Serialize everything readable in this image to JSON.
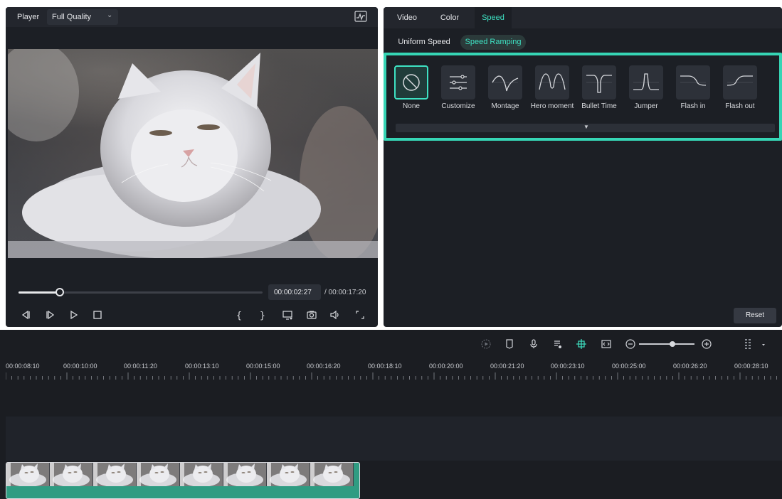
{
  "player": {
    "title": "Player",
    "quality": "Full Quality",
    "current_time": "00:00:02:27",
    "total_time": "/ 00:00:17:20",
    "progress_fraction": 0.17
  },
  "props": {
    "tabs": [
      {
        "label": "Video"
      },
      {
        "label": "Color"
      },
      {
        "label": "Speed"
      }
    ],
    "active_tab": "Speed",
    "subtabs": [
      {
        "label": "Uniform Speed"
      },
      {
        "label": "Speed Ramping"
      }
    ],
    "active_subtab": "Speed Ramping",
    "presets": [
      {
        "label": "None",
        "icon": "none-icon"
      },
      {
        "label": "Customize",
        "icon": "sliders-icon"
      },
      {
        "label": "Montage",
        "icon": "montage-curve-icon"
      },
      {
        "label": "Hero moment",
        "icon": "hero-moment-curve-icon"
      },
      {
        "label": "Bullet Time",
        "icon": "bullet-time-curve-icon"
      },
      {
        "label": "Jumper",
        "icon": "jumper-curve-icon"
      },
      {
        "label": "Flash in",
        "icon": "flash-in-curve-icon"
      },
      {
        "label": "Flash out",
        "icon": "flash-out-curve-icon"
      }
    ],
    "selected_preset": "None",
    "reset_label": "Reset"
  },
  "timeline": {
    "ruler_labels": [
      "00:00:08:10",
      "00:00:10:00",
      "00:00:11:20",
      "00:00:13:10",
      "00:00:15:00",
      "00:00:16:20",
      "00:00:18:10",
      "00:00:20:00",
      "00:00:21:20",
      "00:00:23:10",
      "00:00:25:00",
      "00:00:26:20",
      "00:00:28:10"
    ],
    "zoom_fraction": 0.6
  },
  "colors": {
    "accent": "#3ee2c3",
    "highlight_border": "#36d5b5",
    "panel_bg": "#1c1f25",
    "clip_green": "#2f9c82"
  }
}
